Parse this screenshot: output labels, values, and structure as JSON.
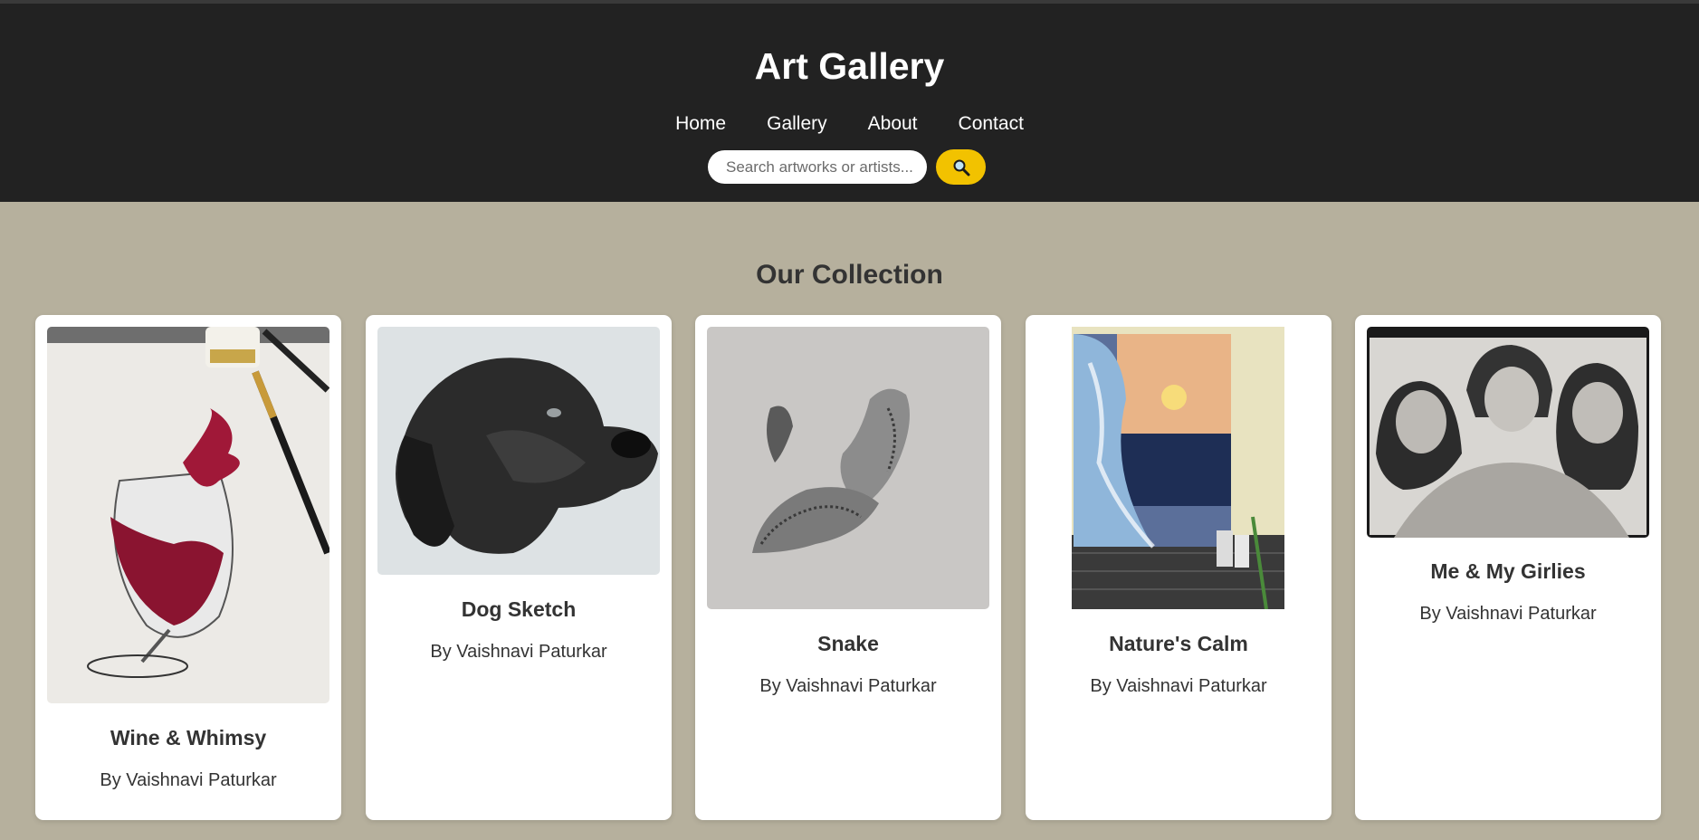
{
  "header": {
    "title": "Art Gallery",
    "nav": [
      "Home",
      "Gallery",
      "About",
      "Contact"
    ],
    "search": {
      "placeholder": "Search artworks or artists...",
      "value": ""
    },
    "search_button_icon": "magnifier-icon"
  },
  "colors": {
    "header_bg": "#222222",
    "page_bg": "#b6b09d",
    "accent": "#f2c200",
    "card_bg": "#ffffff",
    "text": "#333333"
  },
  "collection": {
    "title": "Our Collection",
    "items": [
      {
        "title": "Wine & Whimsy",
        "artist": "By Vaishnavi Paturkar"
      },
      {
        "title": "Dog Sketch",
        "artist": "By Vaishnavi Paturkar"
      },
      {
        "title": "Snake",
        "artist": "By Vaishnavi Paturkar"
      },
      {
        "title": "Nature's Calm",
        "artist": "By Vaishnavi Paturkar"
      },
      {
        "title": "Me & My Girlies",
        "artist": "By Vaishnavi Paturkar"
      }
    ]
  }
}
